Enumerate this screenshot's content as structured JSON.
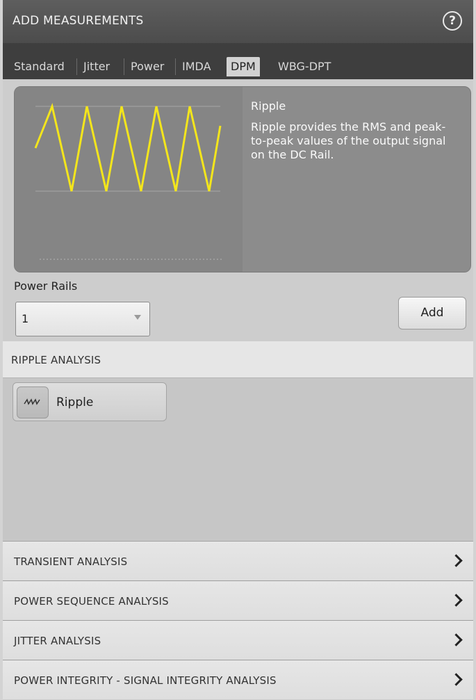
{
  "header": {
    "title": "ADD MEASUREMENTS",
    "help_icon": "question-circle-icon"
  },
  "tabs": [
    {
      "label": "Standard",
      "active": false
    },
    {
      "label": "Jitter",
      "active": false
    },
    {
      "label": "Power",
      "active": false
    },
    {
      "label": "IMDA",
      "active": false
    },
    {
      "label": "DPM",
      "active": true
    },
    {
      "label": "WBG-DPT",
      "active": false
    }
  ],
  "info": {
    "title": "Ripple",
    "description": "Ripple provides the RMS and peak-to-peak values of the output signal on the DC Rail.",
    "waveform_color": "#f3e51c"
  },
  "power_rails": {
    "label": "Power Rails",
    "value": "1"
  },
  "add_button": {
    "label": "Add"
  },
  "ripple_section": {
    "title": "RIPPLE ANALYSIS",
    "items": [
      {
        "label": "Ripple",
        "icon": "ripple-wave-icon"
      }
    ]
  },
  "collapsed_sections": [
    {
      "title": "TRANSIENT ANALYSIS"
    },
    {
      "title": "POWER SEQUENCE ANALYSIS"
    },
    {
      "title": "JITTER ANALYSIS"
    },
    {
      "title": "POWER INTEGRITY - SIGNAL INTEGRITY ANALYSIS"
    }
  ]
}
